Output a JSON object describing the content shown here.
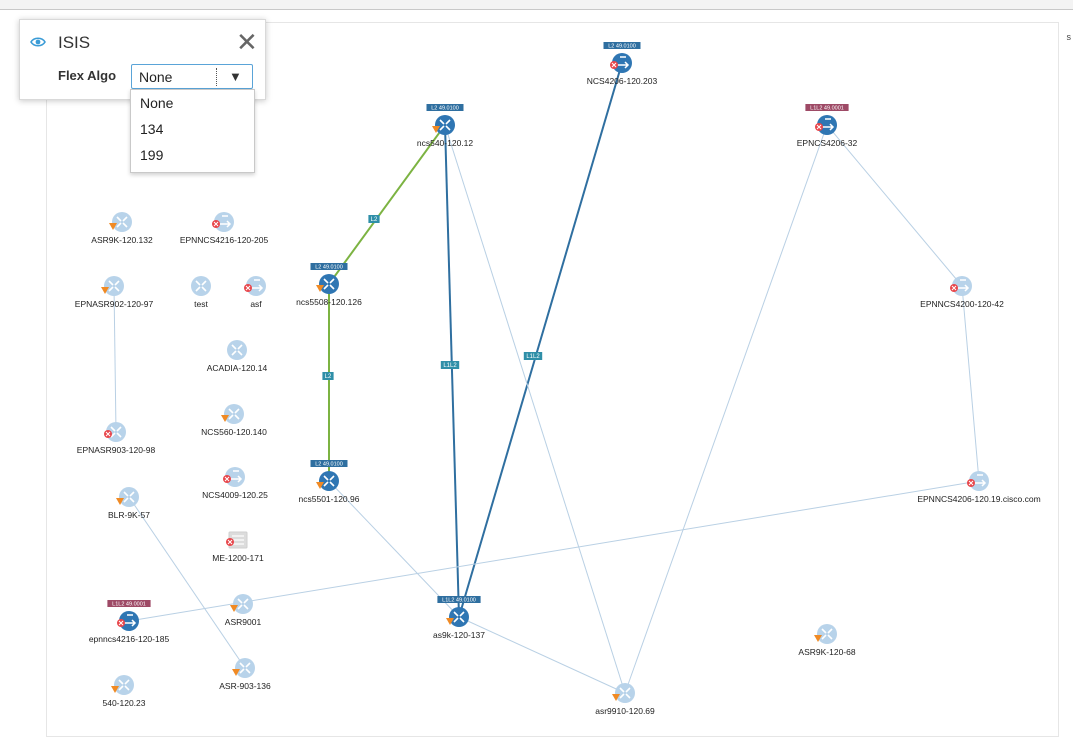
{
  "filter_panel": {
    "title": "ISIS",
    "flex_algo_label": "Flex Algo",
    "selected_value": "None",
    "options": [
      "None",
      "134",
      "199"
    ]
  },
  "colors": {
    "router_blue": "#2f76b3",
    "router_light": "#b8d3ea",
    "link_green": "#7cb342",
    "link_blue": "#2f6fa0",
    "link_light": "#b9d0e4",
    "badge_blue": "#2f6fa0",
    "badge_red": "#9e4a66",
    "alarm_red": "#e8474c",
    "warn_orange": "#f08a24"
  },
  "nodes": [
    {
      "name": "NCS4206-120.203",
      "badge": "L2 49.0100",
      "badge_color": "blue",
      "status": "error",
      "style": "dark",
      "icon": "router-arrows-icon"
    },
    {
      "name": "ncs540-120.12",
      "badge": "L2 49.0100",
      "badge_color": "blue",
      "status": "warning",
      "style": "dark",
      "icon": "router-icon"
    },
    {
      "name": "EPNCS4206-32",
      "badge": "L1L2 49.0001",
      "badge_color": "red",
      "status": "error",
      "style": "dark",
      "icon": "router-arrows-icon"
    },
    {
      "name": "ASR9K-120.132",
      "badge": "",
      "badge_color": "",
      "status": "warning",
      "style": "light",
      "icon": "router-icon"
    },
    {
      "name": "EPNNCS4216-120-205",
      "badge": "",
      "badge_color": "",
      "status": "error",
      "style": "light",
      "icon": "router-arrows-icon"
    },
    {
      "name": "ncs5508-120.126",
      "badge": "L2 49.0100",
      "badge_color": "blue",
      "status": "warning",
      "style": "dark",
      "icon": "router-icon"
    },
    {
      "name": "EPNASR902-120-97",
      "badge": "",
      "badge_color": "",
      "status": "warning",
      "style": "light",
      "icon": "router-icon"
    },
    {
      "name": "test",
      "badge": "",
      "badge_color": "",
      "status": "none",
      "style": "light",
      "icon": "router-icon"
    },
    {
      "name": "asf",
      "badge": "",
      "badge_color": "",
      "status": "error",
      "style": "light",
      "icon": "router-arrows-icon"
    },
    {
      "name": "EPNNCS4200-120-42",
      "badge": "",
      "badge_color": "",
      "status": "error",
      "style": "light",
      "icon": "router-arrows-icon"
    },
    {
      "name": "ACADIA-120.14",
      "badge": "",
      "badge_color": "",
      "status": "none",
      "style": "light",
      "icon": "router-icon"
    },
    {
      "name": "NCS560-120.140",
      "badge": "",
      "badge_color": "",
      "status": "warning",
      "style": "light",
      "icon": "router-icon"
    },
    {
      "name": "EPNASR903-120-98",
      "badge": "",
      "badge_color": "",
      "status": "error",
      "style": "light",
      "icon": "router-icon"
    },
    {
      "name": "ncs5501-120.96",
      "badge": "L2 49.0100",
      "badge_color": "blue",
      "status": "warning",
      "style": "dark",
      "icon": "router-icon"
    },
    {
      "name": "NCS4009-120.25",
      "badge": "",
      "badge_color": "",
      "status": "error",
      "style": "light",
      "icon": "router-arrows-icon"
    },
    {
      "name": "BLR-9K-57",
      "badge": "",
      "badge_color": "",
      "status": "warning",
      "style": "light",
      "icon": "router-icon"
    },
    {
      "name": "EPNNCS4206-120.19.cisco.com",
      "badge": "",
      "badge_color": "",
      "status": "error",
      "style": "light",
      "icon": "router-arrows-icon"
    },
    {
      "name": "ME-1200-171",
      "badge": "",
      "badge_color": "",
      "status": "error",
      "style": "light",
      "icon": "switch-icon"
    },
    {
      "name": "as9k-120-137",
      "badge": "L1L2 49.0100",
      "badge_color": "blue",
      "status": "warning",
      "style": "dark",
      "icon": "router-icon"
    },
    {
      "name": "ASR9001",
      "badge": "",
      "badge_color": "",
      "status": "warning",
      "style": "light",
      "icon": "router-icon"
    },
    {
      "name": "epnncs4216-120-185",
      "badge": "L1L2 49.0001",
      "badge_color": "red",
      "status": "error",
      "style": "dark",
      "icon": "router-arrows-icon"
    },
    {
      "name": "ASR-903-136",
      "badge": "",
      "badge_color": "",
      "status": "warning",
      "style": "light",
      "icon": "router-icon"
    },
    {
      "name": "540-120.23",
      "badge": "",
      "badge_color": "",
      "status": "warning",
      "style": "light",
      "icon": "router-icon"
    },
    {
      "name": "ASR9K-120-68",
      "badge": "",
      "badge_color": "",
      "status": "warning",
      "style": "light",
      "icon": "router-icon"
    },
    {
      "name": "asr9910-120.69",
      "badge": "",
      "badge_color": "",
      "status": "warning",
      "style": "light",
      "icon": "router-icon"
    }
  ],
  "links": [
    {
      "from": "ncs540-120.12",
      "to": "ncs5508-120.126",
      "style": "green",
      "label": "L2"
    },
    {
      "from": "ncs5508-120.126",
      "to": "ncs5501-120.96",
      "style": "green",
      "label": "L2"
    },
    {
      "from": "ncs540-120.12",
      "to": "as9k-120-137",
      "style": "blue",
      "label": "L1L2"
    },
    {
      "from": "NCS4206-120.203",
      "to": "as9k-120-137",
      "style": "blue",
      "label": "L1L2"
    },
    {
      "from": "ncs540-120.12",
      "to": "asr9910-120.69",
      "style": "light",
      "label": ""
    },
    {
      "from": "ncs5501-120.96",
      "to": "as9k-120-137",
      "style": "light",
      "label": ""
    },
    {
      "from": "as9k-120-137",
      "to": "asr9910-120.69",
      "style": "light",
      "label": ""
    },
    {
      "from": "EPNCS4206-32",
      "to": "asr9910-120.69",
      "style": "light",
      "label": ""
    },
    {
      "from": "EPNCS4206-32",
      "to": "EPNNCS4200-120-42",
      "style": "light",
      "label": ""
    },
    {
      "from": "EPNNCS4200-120-42",
      "to": "EPNNCS4206-120.19.cisco.com",
      "style": "light",
      "label": ""
    },
    {
      "from": "EPNNCS4206-120.19.cisco.com",
      "to": "epnncs4216-120-185",
      "style": "light",
      "label": ""
    },
    {
      "from": "EPNASR902-120-97",
      "to": "EPNASR903-120-98",
      "style": "light",
      "label": ""
    },
    {
      "from": "BLR-9K-57",
      "to": "ASR-903-136",
      "style": "light",
      "label": ""
    }
  ]
}
